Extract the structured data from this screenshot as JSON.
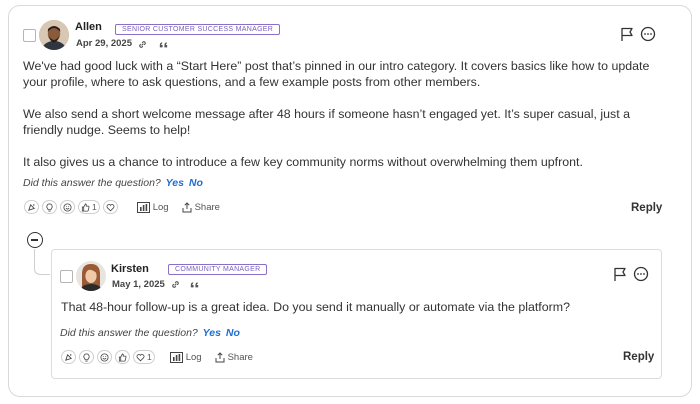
{
  "post": {
    "author": "Allen",
    "role": "SENIOR CUSTOMER SUCCESS MANAGER",
    "date": "Apr 29, 2025",
    "paragraphs": [
      "We've had good luck with a “Start Here” post that’s pinned in our intro category. It covers basics like how to update your profile, where to ask questions, and a few example posts from other members.",
      "We also send a short welcome message after 48 hours if someone hasn’t engaged yet. It’s super casual, just a friendly nudge. Seems to help!",
      "It also gives us a chance to introduce a few key community norms without overwhelming them upfront."
    ],
    "question": "Did this answer the question?",
    "yes": "Yes",
    "no": "No",
    "like_count": "1",
    "log_label": "Log",
    "share_label": "Share",
    "reply_label": "Reply"
  },
  "reply": {
    "author": "Kirsten",
    "role": "COMMUNITY MANAGER",
    "date": "May 1, 2025",
    "text": "That 48-hour follow-up is a great idea. Do you send it manually or automate via the platform?",
    "question": "Did this answer the question?",
    "yes": "Yes",
    "no": "No",
    "heart_count": "1",
    "log_label": "Log",
    "share_label": "Share",
    "reply_label": "Reply"
  },
  "colors": {
    "accent_link": "#1f6fd1",
    "badge_purple": "#7a5fc0"
  },
  "icons": [
    "link-icon",
    "quote-icon",
    "flag-icon",
    "more-options-icon",
    "celebrate-icon",
    "lightbulb-icon",
    "smile-icon",
    "thumbs-up-icon",
    "heart-icon",
    "log-icon",
    "share-icon",
    "collapse-icon"
  ]
}
